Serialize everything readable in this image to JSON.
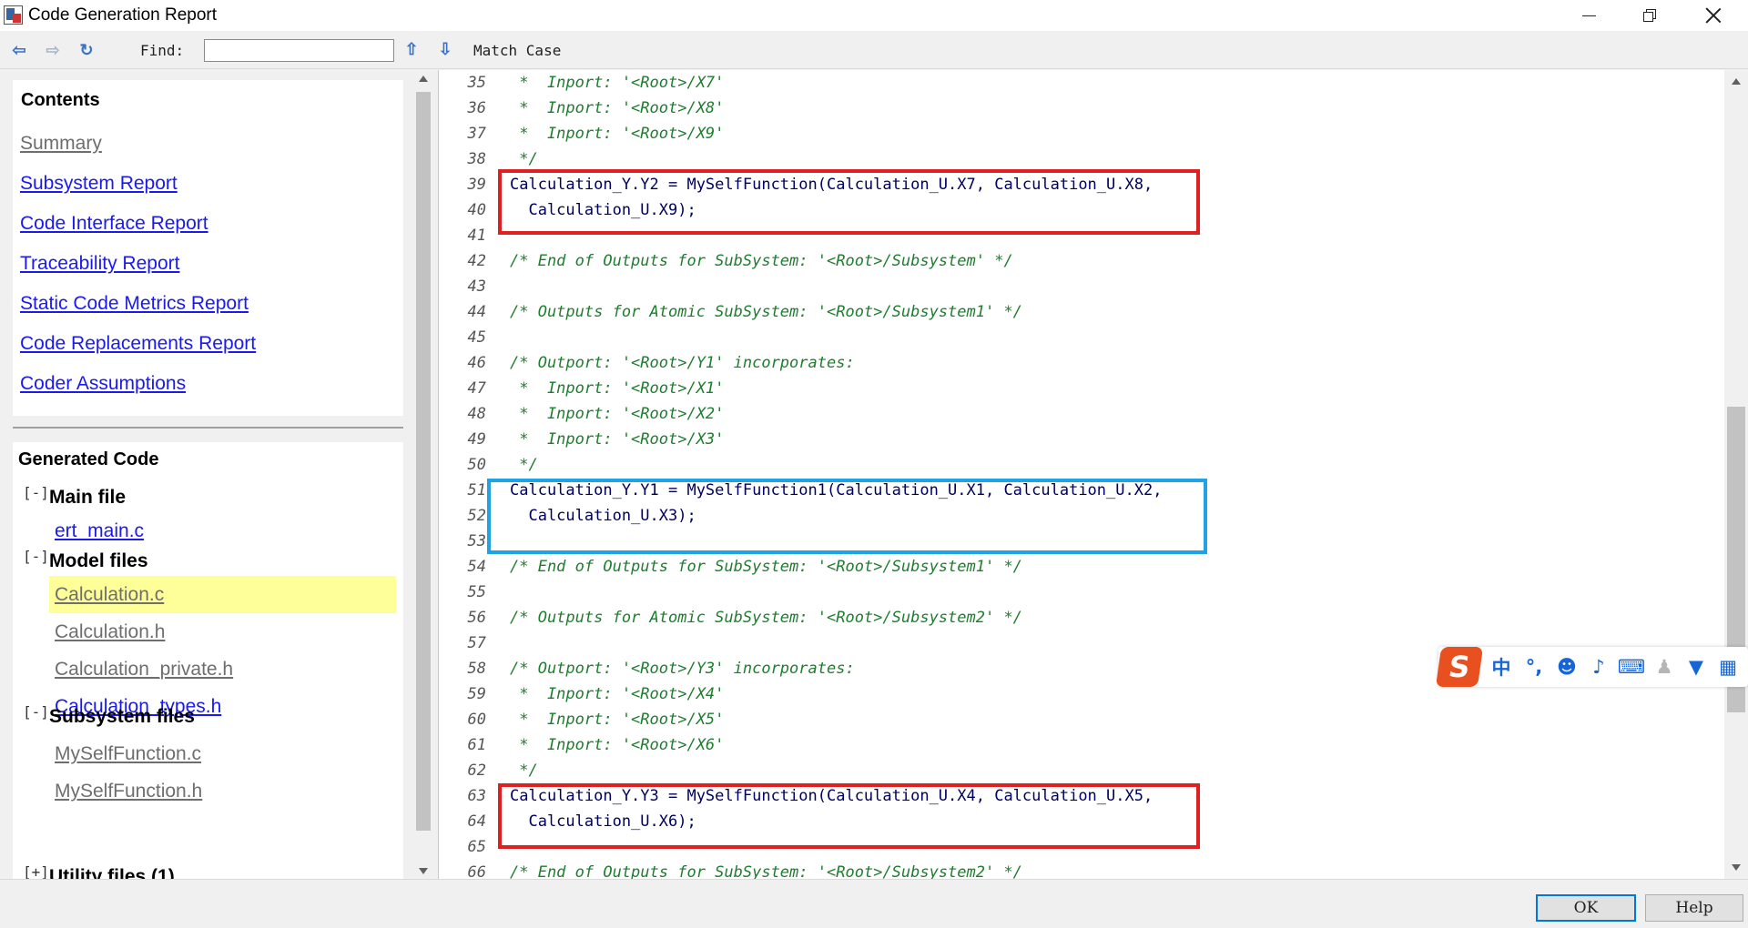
{
  "window": {
    "title": "Code Generation Report"
  },
  "toolbar": {
    "find_label": "Find:",
    "find_value": "",
    "match_case_label": "Match Case"
  },
  "contents": {
    "title": "Contents",
    "links": [
      {
        "label": "Summary",
        "visited": true
      },
      {
        "label": "Subsystem Report",
        "visited": false
      },
      {
        "label": "Code Interface Report",
        "visited": false
      },
      {
        "label": "Traceability Report",
        "visited": false
      },
      {
        "label": "Static Code Metrics Report",
        "visited": false
      },
      {
        "label": "Code Replacements Report",
        "visited": false
      },
      {
        "label": "Coder Assumptions",
        "visited": false
      }
    ]
  },
  "generated_code": {
    "title": "Generated Code",
    "toggle_symbol": "[-]",
    "groups": [
      {
        "title": "Main file",
        "files": [
          {
            "name": "ert_main.c",
            "visited": false
          }
        ]
      },
      {
        "title": "Model files",
        "files": [
          {
            "name": "Calculation.c",
            "visited": true,
            "active": true
          },
          {
            "name": "Calculation.h",
            "visited": true
          },
          {
            "name": "Calculation_private.h",
            "visited": true
          },
          {
            "name": "Calculation_types.h",
            "visited": false
          }
        ]
      },
      {
        "title": "Subsystem files",
        "files": [
          {
            "name": "MySelfFunction.c",
            "visited": true
          },
          {
            "name": "MySelfFunction.h",
            "visited": true
          }
        ]
      },
      {
        "title": "Utility files (1)",
        "toggle": "[+]",
        "files": []
      }
    ]
  },
  "code_lines": [
    {
      "n": "35",
      "text": " *  Inport: '<Root>/X7'",
      "comment": true
    },
    {
      "n": "36",
      "text": " *  Inport: '<Root>/X8'",
      "comment": true
    },
    {
      "n": "37",
      "text": " *  Inport: '<Root>/X9'",
      "comment": true
    },
    {
      "n": "38",
      "text": " */",
      "comment": true
    },
    {
      "n": "39",
      "text": "Calculation_Y.Y2 = MySelfFunction(Calculation_U.X7, Calculation_U.X8,",
      "comment": false
    },
    {
      "n": "40",
      "text": "  Calculation_U.X9);",
      "comment": false
    },
    {
      "n": "41",
      "text": "",
      "comment": false
    },
    {
      "n": "42",
      "text": "/* End of Outputs for SubSystem: '<Root>/Subsystem' */",
      "comment": true
    },
    {
      "n": "43",
      "text": "",
      "comment": false
    },
    {
      "n": "44",
      "text": "/* Outputs for Atomic SubSystem: '<Root>/Subsystem1' */",
      "comment": true
    },
    {
      "n": "45",
      "text": "",
      "comment": false
    },
    {
      "n": "46",
      "text": "/* Outport: '<Root>/Y1' incorporates:",
      "comment": true
    },
    {
      "n": "47",
      "text": " *  Inport: '<Root>/X1'",
      "comment": true
    },
    {
      "n": "48",
      "text": " *  Inport: '<Root>/X2'",
      "comment": true
    },
    {
      "n": "49",
      "text": " *  Inport: '<Root>/X3'",
      "comment": true
    },
    {
      "n": "50",
      "text": " */",
      "comment": true
    },
    {
      "n": "51",
      "text": "Calculation_Y.Y1 = MySelfFunction1(Calculation_U.X1, Calculation_U.X2,",
      "comment": false
    },
    {
      "n": "52",
      "text": "  Calculation_U.X3);",
      "comment": false
    },
    {
      "n": "53",
      "text": "",
      "comment": false
    },
    {
      "n": "54",
      "text": "/* End of Outputs for SubSystem: '<Root>/Subsystem1' */",
      "comment": true
    },
    {
      "n": "55",
      "text": "",
      "comment": false
    },
    {
      "n": "56",
      "text": "/* Outputs for Atomic SubSystem: '<Root>/Subsystem2' */",
      "comment": true
    },
    {
      "n": "57",
      "text": "",
      "comment": false
    },
    {
      "n": "58",
      "text": "/* Outport: '<Root>/Y3' incorporates:",
      "comment": true
    },
    {
      "n": "59",
      "text": " *  Inport: '<Root>/X4'",
      "comment": true
    },
    {
      "n": "60",
      "text": " *  Inport: '<Root>/X5'",
      "comment": true
    },
    {
      "n": "61",
      "text": " *  Inport: '<Root>/X6'",
      "comment": true
    },
    {
      "n": "62",
      "text": " */",
      "comment": true
    },
    {
      "n": "63",
      "text": "Calculation_Y.Y3 = MySelfFunction(Calculation_U.X4, Calculation_U.X5,",
      "comment": false
    },
    {
      "n": "64",
      "text": "  Calculation_U.X6);",
      "comment": false
    },
    {
      "n": "65",
      "text": "",
      "comment": false
    },
    {
      "n": "66",
      "text": "/* End of Outputs for SubSystem: '<Root>/Subsystem2' */",
      "comment": true
    }
  ],
  "ime": {
    "logo": "S",
    "mode": "中",
    "punct": "°,",
    "icons": [
      "emoji-icon",
      "microphone-icon",
      "keyboard-icon",
      "user-icon",
      "shirt-icon",
      "apps-icon"
    ]
  },
  "buttons": {
    "ok": "OK",
    "help": "Help"
  },
  "colors": {
    "highlight_red": "#e02020",
    "highlight_blue": "#1fa3e6",
    "active_file_bg": "#ffff99",
    "link": "#1a1aee",
    "comment": "#1e7d2e"
  }
}
